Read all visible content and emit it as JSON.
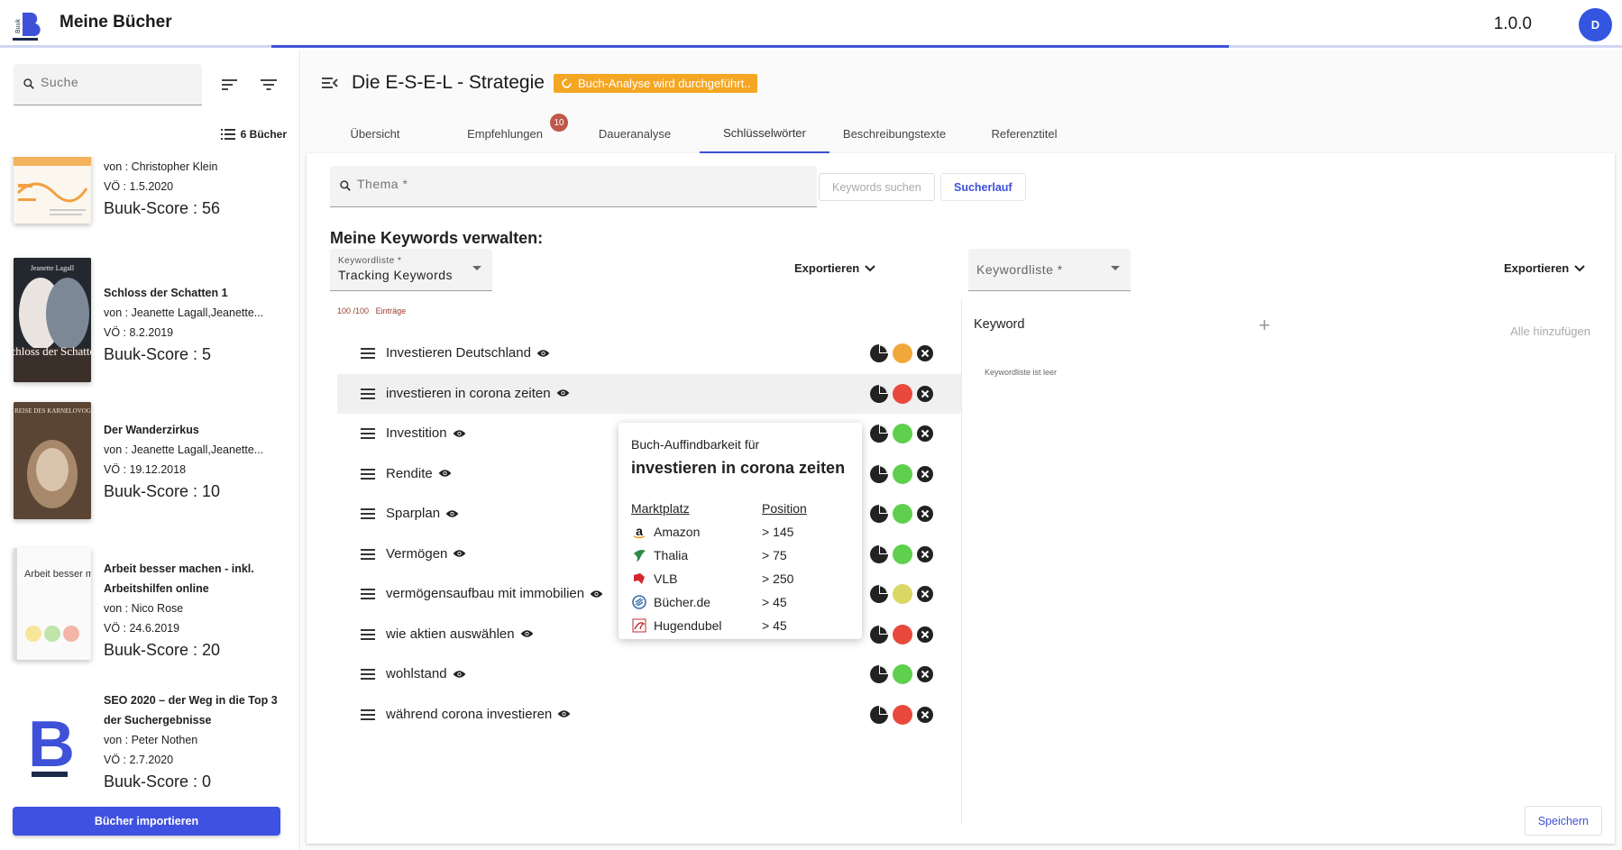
{
  "app": {
    "title": "Meine Bücher",
    "version": "1.0.0",
    "avatar_initial": "D",
    "logo_text": "Buuk"
  },
  "sidebar": {
    "search_placeholder": "Suche",
    "book_count": "6 Bücher",
    "books": [
      {
        "title": "",
        "author": "von : Christopher Klein",
        "date": "VÖ : 1.5.2020",
        "score": "Buuk-Score : 56",
        "cover": "orange"
      },
      {
        "title": "Schloss der Schatten 1",
        "author": "von : Jeanette Lagall,Jeanette...",
        "date": "VÖ : 8.2.2019",
        "score": "Buuk-Score : 5",
        "cover": "dark",
        "cover_top": "Jeanette Lagall",
        "cover_title": "Schloss der Schatten"
      },
      {
        "title": "Der Wanderzirkus",
        "author": "von : Jeanette Lagall,Jeanette...",
        "date": "VÖ : 19.12.2018",
        "score": "Buuk-Score : 10",
        "cover": "brown",
        "cover_title": "DIE REISE DES KARNELOVOGELS"
      },
      {
        "title": "Arbeit besser machen - inkl. Arbeitshilfen online",
        "author": "von : Nico Rose",
        "date": "VÖ : 24.6.2019",
        "score": "Buuk-Score : 20",
        "cover": "white",
        "cover_title": "Arbeit besser machen"
      },
      {
        "title": "SEO 2020 – der Weg in die Top 3 der Suchergebnisse",
        "author": "von : Peter Nothen",
        "date": "VÖ : 2.7.2020",
        "score": "Buuk-Score : 0",
        "cover": "logo",
        "cover_title": "B"
      }
    ],
    "import_button": "Bücher importieren"
  },
  "main": {
    "book_title": "Die E-S-E-L - Strategie",
    "status_chip": "Buch-Analyse wird durchgeführt..",
    "tabs": [
      {
        "label": "Übersicht"
      },
      {
        "label": "Empfehlungen",
        "badge": "10"
      },
      {
        "label": "Daueranalyse"
      },
      {
        "label": "Schlüsselwörter",
        "active": true
      },
      {
        "label": "Beschreibungstexte"
      },
      {
        "label": "Referenztitel"
      }
    ],
    "thema_placeholder": "Thema *",
    "keywords_search_button": "Keywords suchen",
    "search_run_button": "Sucherlauf",
    "section_title": "Meine Keywords verwalten:",
    "left_select": {
      "label": "Keywordliste *",
      "value": "Tracking Keywords"
    },
    "right_select": {
      "label": "Keywordliste *"
    },
    "export_label": "Exportieren",
    "counter": "100 /100",
    "counter_suffix": "Einträge",
    "keywords": [
      {
        "label": "Investieren Deutschland",
        "status": "#f2a73b"
      },
      {
        "label": "investieren in corona zeiten",
        "status": "#e8493c",
        "hover": true
      },
      {
        "label": "Investition",
        "status": "#5fcf4e"
      },
      {
        "label": "Rendite",
        "status": "#5fcf4e"
      },
      {
        "label": "Sparplan",
        "status": "#5fcf4e"
      },
      {
        "label": "Vermögen",
        "status": "#5fcf4e"
      },
      {
        "label": "vermögensaufbau mit immobilien",
        "status": "#dbd764"
      },
      {
        "label": "wie aktien auswählen",
        "status": "#e8493c"
      },
      {
        "label": "wohlstand",
        "status": "#5fcf4e"
      },
      {
        "label": "während corona investieren",
        "status": "#e8493c"
      }
    ],
    "tooltip": {
      "heading": "Buch-Auffindbarkeit für",
      "keyword": "investieren in corona zeiten",
      "col_marketplace": "Marktplatz",
      "col_position": "Position",
      "rows": [
        {
          "marketplace": "Amazon",
          "position": "> 145",
          "icon": "amazon-icon"
        },
        {
          "marketplace": "Thalia",
          "position": "> 75",
          "icon": "thalia-icon"
        },
        {
          "marketplace": "VLB",
          "position": "> 250",
          "icon": "vlb-icon"
        },
        {
          "marketplace": "Bücher.de",
          "position": "> 45",
          "icon": "buecher-de-icon"
        },
        {
          "marketplace": "Hugendubel",
          "position": "> 45",
          "icon": "hugendubel-icon"
        }
      ]
    },
    "right_panel": {
      "header": "Keyword",
      "add_all": "Alle hinzufügen",
      "empty": "Keywordliste ist leer"
    },
    "save_button": "Speichern"
  },
  "colors": {
    "primary": "#3f51d8",
    "warning": "#f5a623",
    "badge": "#c0574a"
  }
}
